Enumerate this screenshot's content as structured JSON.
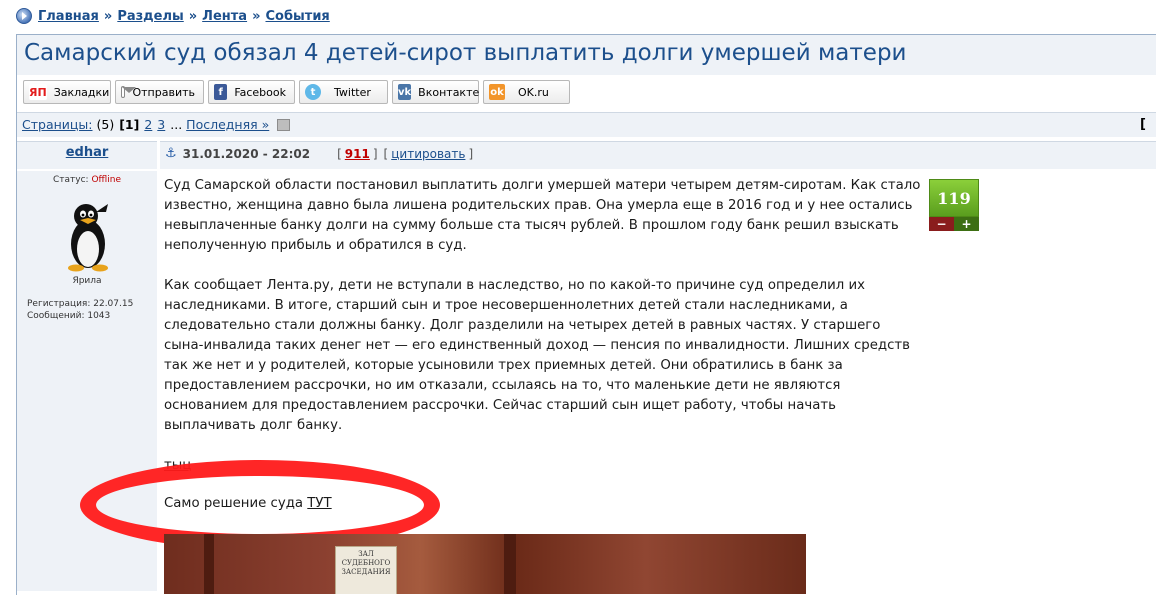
{
  "breadcrumb": {
    "home": "Главная",
    "sections": "Разделы",
    "feed": "Лента",
    "events": "События",
    "sep": "»"
  },
  "title": "Самарский суд обязал 4 детей-сирот выплатить долги умершей матери",
  "share": [
    {
      "label": "Закладки",
      "icon": "yandex-bookmarks-icon",
      "glyph": "ЯП"
    },
    {
      "label": "Отправить",
      "icon": "mail-icon",
      "glyph": ""
    },
    {
      "label": "Facebook",
      "icon": "facebook-icon",
      "glyph": "f"
    },
    {
      "label": "Twitter",
      "icon": "twitter-icon",
      "glyph": "t"
    },
    {
      "label": "Вконтакте",
      "icon": "vk-icon",
      "glyph": "vk"
    },
    {
      "label": "OK.ru",
      "icon": "odnoklassniki-icon",
      "glyph": "ok"
    }
  ],
  "pagination": {
    "label": "Страницы:",
    "total": "(5)",
    "current": "[1]",
    "p2": "2",
    "p3": "3",
    "ellipsis": "...",
    "last": "Последняя »",
    "right": "["
  },
  "post": {
    "author": "edhar",
    "date": "31.01.2020 - 22:02",
    "number": "911",
    "quote": "цитировать",
    "status_label": "Статус:",
    "status": "Offline",
    "rank": "Ярила",
    "registered": "Регистрация: 22.07.15",
    "messages": "Сообщений: 1043",
    "rating": "119",
    "p1": "Суд Самарской области постановил выплатить долги умершей матери четырем детям-сиротам. Как стало известно, женщина давно была лишена родительских прав. Она умерла еще в 2016 год и у нее остались невыплаченные банку долги на сумму больше ста тысяч рублей. В прошлом году банк решил взыскать неполученную прибыль и обратился в суд.",
    "p2": "Как сообщает Лента.ру, дети не вступали в наследство, но по какой-то причине суд определил их наследниками. В итоге, старший сын и трое несовершеннолетних детей стали наследниками, а следовательно стали должны банку. Долг разделили на четырех детей в равных частях. У старшего сына-инвалида таких денег нет — его единственный доход — пенсия по инвалидности. Лишних средств так же нет и у родителей, которые усыновили трех приемных детей. Они обратились в банк за предоставлением рассрочки, но им отказали, ссылаясь на то, что маленькие дети не являются основанием для предоставлением рассрочки. Сейчас старший сын ищет работу, чтобы начать выплачивать долг банку.",
    "link": "тыц",
    "decision_text": "Само решение суда ",
    "decision_link": "ТУТ",
    "sign_text": "ЗАЛ СУДЕБНОГО ЗАСЕДАНИЯ"
  },
  "colors": {
    "link": "#1c4f8c",
    "header_bg": "#eef2f7",
    "highlight": "#ff1a1a",
    "rating": "#6bb52a"
  }
}
